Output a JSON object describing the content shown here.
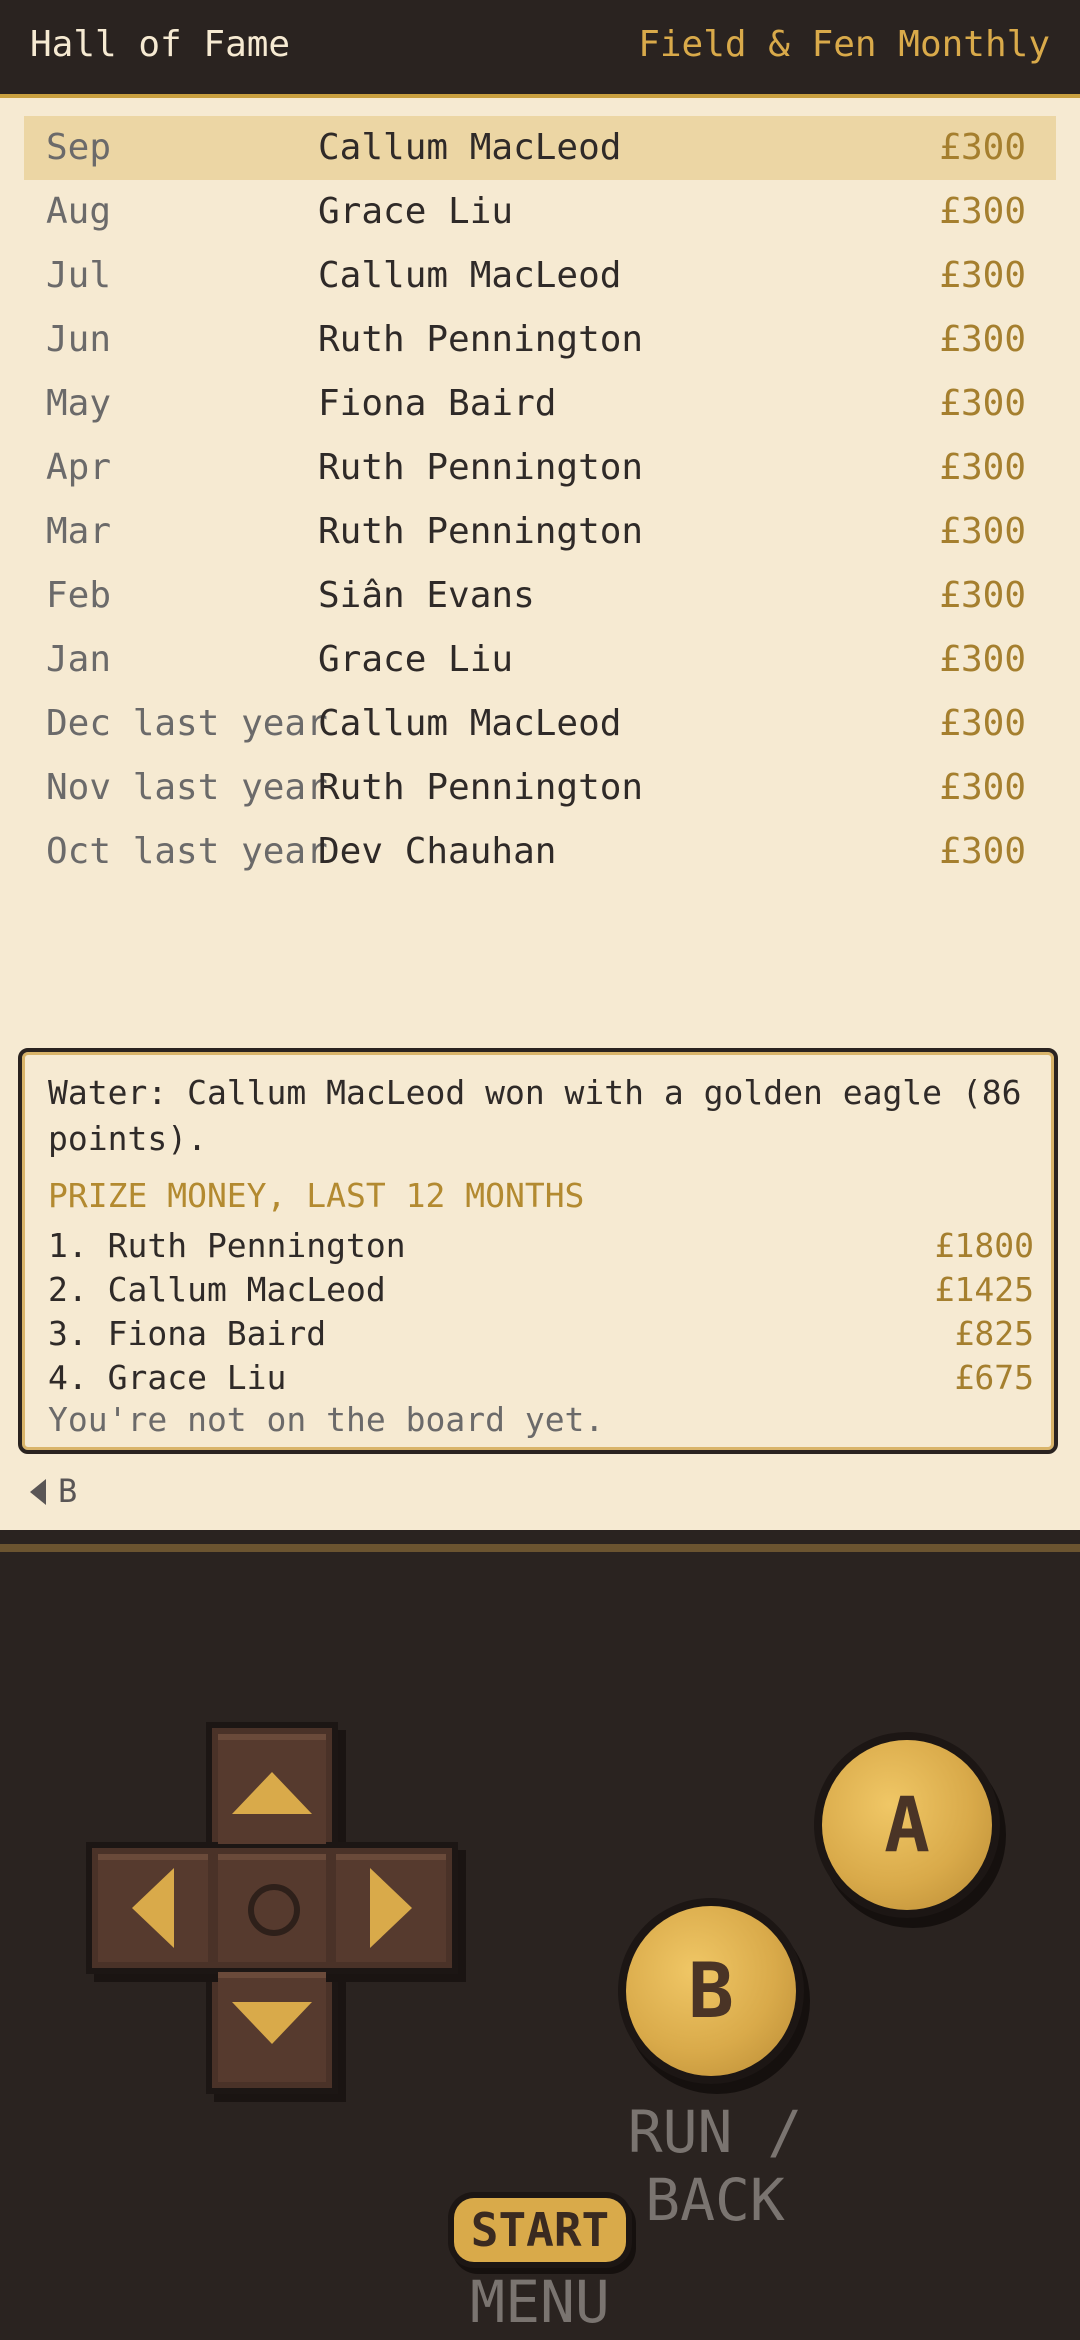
{
  "header": {
    "title": "Hall of Fame",
    "subtitle": "Field & Fen Monthly"
  },
  "winners": [
    {
      "month": "Sep",
      "name": "Callum MacLeod",
      "prize": "£300",
      "selected": true
    },
    {
      "month": "Aug",
      "name": "Grace Liu",
      "prize": "£300"
    },
    {
      "month": "Jul",
      "name": "Callum MacLeod",
      "prize": "£300"
    },
    {
      "month": "Jun",
      "name": "Ruth Pennington",
      "prize": "£300"
    },
    {
      "month": "May",
      "name": "Fiona Baird",
      "prize": "£300"
    },
    {
      "month": "Apr",
      "name": "Ruth Pennington",
      "prize": "£300"
    },
    {
      "month": "Mar",
      "name": "Ruth Pennington",
      "prize": "£300"
    },
    {
      "month": "Feb",
      "name": "Siân Evans",
      "prize": "£300"
    },
    {
      "month": "Jan",
      "name": "Grace Liu",
      "prize": "£300"
    },
    {
      "month": "Dec last year",
      "name": "Callum MacLeod",
      "prize": "£300"
    },
    {
      "month": "Nov last year",
      "name": "Ruth Pennington",
      "prize": "£300"
    },
    {
      "month": "Oct last year",
      "name": "Dev Chauhan",
      "prize": "£300"
    }
  ],
  "detail": {
    "message": "Water: Callum MacLeod won with a golden eagle (86 points).",
    "leaderboard_heading": "PRIZE MONEY, LAST 12 MONTHS",
    "leaderboard": [
      {
        "name": "1. Ruth Pennington",
        "amount": "£1800"
      },
      {
        "name": "2. Callum MacLeod",
        "amount": "£1425"
      },
      {
        "name": "3. Fiona Baird",
        "amount": "£825"
      },
      {
        "name": "4. Grace Liu",
        "amount": "£675"
      }
    ],
    "note": "You're not on the board yet."
  },
  "back_hint": "B",
  "controls": {
    "a_label": "A",
    "b_label": "B",
    "b_caption": "RUN / BACK",
    "start_label": "START",
    "start_caption": "MENU"
  },
  "colors": {
    "screen_bg": "#f6ead2",
    "accent": "#d9aa4a",
    "selected_row": "#ecd6a4",
    "console_bg": "#2a2320"
  }
}
